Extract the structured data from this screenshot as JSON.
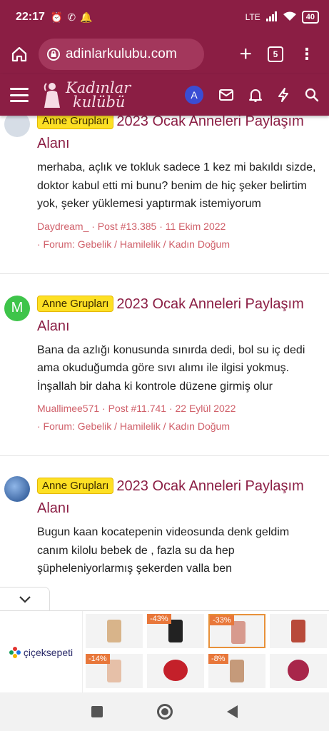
{
  "status_bar": {
    "time": "22:17",
    "battery": "40",
    "network": "LTE"
  },
  "browser": {
    "url": "adinlarkulubu.com",
    "tab_count": "5"
  },
  "site": {
    "logo_line1": "Kadınlar",
    "logo_line2": "kulübü",
    "user_initial": "A",
    "brand_color": "#8b1e44"
  },
  "posts": [
    {
      "badge": "Anne Grupları",
      "title": "2023 Ocak Anneleri Paylaşım Alanı",
      "body": "merhaba, açlık ve tokluk sadece 1 kez mi bakıldı sizde, doktor kabul etti mi bunu? benim de hiç şeker belirtim yok, şeker yüklemesi yaptırmak istemiyorum",
      "meta_line1": "Daydream_ · Post #13.385 · 11 Ekim 2022",
      "meta_line2": "· Forum: Gebelik / Hamilelik / Kadın Doğum",
      "avatar_letter": "",
      "avatar_color": "#c9d3e0"
    },
    {
      "badge": "Anne Grupları",
      "title": "2023 Ocak Anneleri Paylaşım Alanı",
      "body": "Bana da azlığı konusunda sınırda dedi, bol su iç dedi ama okuduğumda göre sıvı alımı ile ilgisi yokmuş. İnşallah bir daha ki kontrole düzene girmiş olur",
      "meta_line1": "Muallimee571 · Post #11.741 · 22 Eylül 2022",
      "meta_line2": "· Forum: Gebelik / Hamilelik / Kadın Doğum",
      "avatar_letter": "M",
      "avatar_color": "#3ec44a"
    },
    {
      "badge": "Anne Grupları",
      "title": "2023 Ocak Anneleri Paylaşım Alanı",
      "body": "Bugun kaan kocatepenin videosunda denk geldim canım kilolu bebek de , fazla su da hep şüpheleniyorlarmış şekerden valla ben",
      "meta_line1": "",
      "meta_line2": "",
      "avatar_letter": "",
      "avatar_color": "#2e5fa8"
    }
  ],
  "ad": {
    "brand": "çiçeksepeti",
    "items": [
      {
        "discount": "",
        "color": "#d8b48a"
      },
      {
        "discount": "-43%",
        "color": "#222222"
      },
      {
        "discount": "-33%",
        "color": "#d79a8e"
      },
      {
        "discount": "",
        "color": "#b84a3a"
      },
      {
        "discount": "-14%",
        "color": "#e6c0a8"
      },
      {
        "discount": "",
        "color": "#c4202a"
      },
      {
        "discount": "-8%",
        "color": "#c59a7a"
      },
      {
        "discount": "",
        "color": "#a8264a"
      }
    ]
  }
}
